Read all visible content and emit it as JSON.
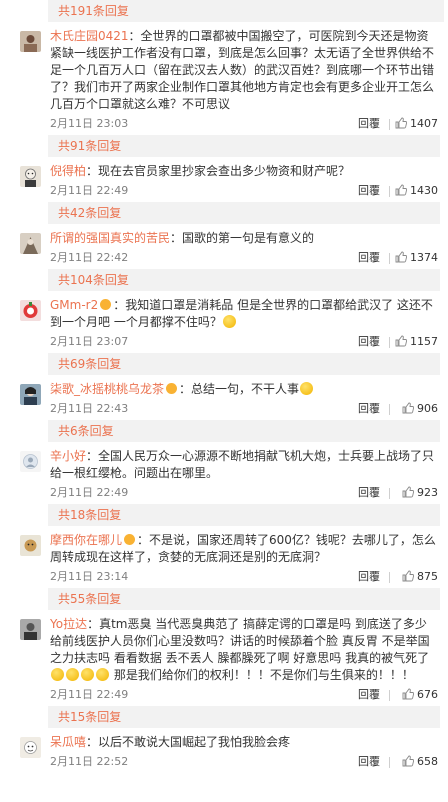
{
  "comments": [
    {
      "replies_label": "共191条回复"
    },
    {
      "user": "木氏庄园0421",
      "text": "：全世界的口罩都被中国搬空了，可医院到今天还是物资紧缺一线医护工作者没有口罩，到底是怎么回事？太无语了全世界供给不足一个几百万人口（留在武汉去人数）的武汉百姓？到底哪一个环节出错了？我们市开了两家企业制作口罩其他地方肯定也会有更多企业开工怎么几百万个口罩就这么难？不可思议",
      "time": "2月11日 23:03",
      "reply": "回覆",
      "likes": "1407",
      "replies_label": "共91条回复"
    },
    {
      "user": "倪得柏",
      "text": "：现在去官员家里抄家会查出多少物资和财产呢？",
      "time": "2月11日 22:49",
      "reply": "回覆",
      "likes": "1430",
      "replies_label": "共42条回复"
    },
    {
      "user": "所谓的强国真实的苦民",
      "text": "：国歌的第一句是有意义的",
      "time": "2月11日 22:42",
      "reply": "回覆",
      "likes": "1374",
      "replies_label": "共104条回复"
    },
    {
      "user": "GMm-r2",
      "text": "：我知道口罩是消耗品 但是全世界的口罩都给武汉了 这还不到一个月吧 一个月都撑不住吗？",
      "time": "2月11日 23:07",
      "reply": "回覆",
      "likes": "1157",
      "replies_label": "共69条回复"
    },
    {
      "user": "柒歌_冰摇桃桃乌龙茶",
      "text": "：总结一句，不干人事",
      "time": "2月11日 22:43",
      "reply": "回覆",
      "likes": "906",
      "replies_label": "共6条回复"
    },
    {
      "user": "辛小好",
      "text": "：全国人民万众一心源源不断地捐献飞机大炮，士兵要上战场了只给一根红缨枪。问题出在哪里。",
      "time": "2月11日 22:49",
      "reply": "回覆",
      "likes": "923",
      "replies_label": "共18条回复"
    },
    {
      "user": "摩西你在哪儿",
      "text": "：不是说，国家还周转了600亿？钱呢？去哪儿了，怎么周转成现在这样了，贪婪的无底洞还是别的无底洞？",
      "time": "2月11日 23:14",
      "reply": "回覆",
      "likes": "875",
      "replies_label": "共55条回复"
    },
    {
      "user": "Yo拉达",
      "text": "：真tm恶臭 当代恶臭典范了 搞薛定谔的口罩是吗 到底送了多少给前线医护人员你们心里没数吗？讲话的时候舔着个脸 真反胃 不是举国之力扶志吗 看看数据 丢不丢人 臊都臊死了啊 好意思吗 我真的被气死了",
      "text2": " 那是我们给你们的权利！！！不是你们与生俱来的！！！",
      "time": "2月11日 22:49",
      "reply": "回覆",
      "likes": "676",
      "replies_label": "共15条回复"
    },
    {
      "user": "呆瓜嘻",
      "text": "：以后不敢说大国崛起了我怕我脸会疼",
      "time": "2月11日 22:52",
      "reply": "回覆",
      "likes": "658"
    }
  ]
}
